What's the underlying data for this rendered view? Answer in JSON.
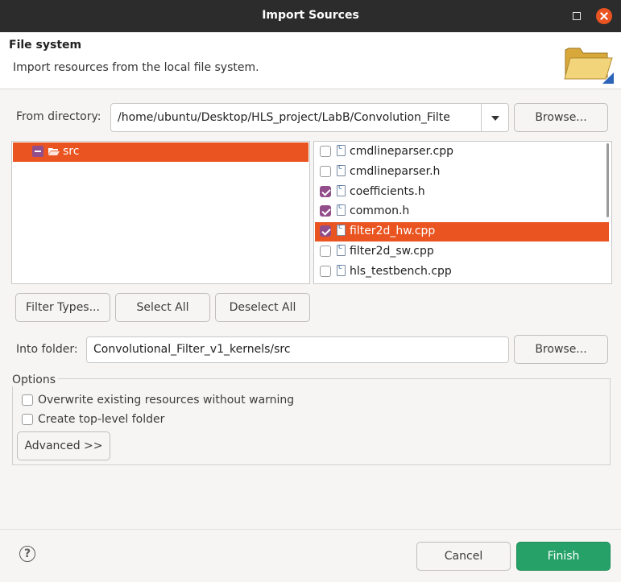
{
  "window": {
    "title": "Import Sources"
  },
  "header": {
    "title": "File system",
    "description": "Import resources from the local file system."
  },
  "from_directory": {
    "label": "From directory:",
    "value": "/home/ubuntu/Desktop/HLS_project/LabB/Convolution_Filte",
    "browse_label": "Browse..."
  },
  "tree": {
    "items": [
      {
        "label": "src",
        "checked": "partial",
        "selected": true
      }
    ]
  },
  "files": {
    "items": [
      {
        "name": "cmdlineparser.cpp",
        "checked": false
      },
      {
        "name": "cmdlineparser.h",
        "checked": false
      },
      {
        "name": "coefficients.h",
        "checked": true
      },
      {
        "name": "common.h",
        "checked": true
      },
      {
        "name": "filter2d_hw.cpp",
        "checked": true,
        "selected": true
      },
      {
        "name": "filter2d_sw.cpp",
        "checked": false
      },
      {
        "name": "hls_testbench.cpp",
        "checked": false
      }
    ]
  },
  "selection_buttons": {
    "filter_types": "Filter Types...",
    "select_all": "Select All",
    "deselect_all": "Deselect All"
  },
  "into_folder": {
    "label": "Into folder:",
    "value": "Convolutional_Filter_v1_kernels/src",
    "browse_label": "Browse..."
  },
  "options": {
    "title": "Options",
    "overwrite_label": "Overwrite existing resources without warning",
    "overwrite_checked": false,
    "toplevel_label": "Create top-level folder",
    "toplevel_checked": false,
    "advanced_label": "Advanced >>"
  },
  "footer": {
    "help_glyph": "?",
    "cancel_label": "Cancel",
    "finish_label": "Finish"
  },
  "colors": {
    "accent": "#e95420",
    "checkbox": "#924d8b",
    "finish": "#26a269",
    "titlebar": "#2c2c2c"
  }
}
